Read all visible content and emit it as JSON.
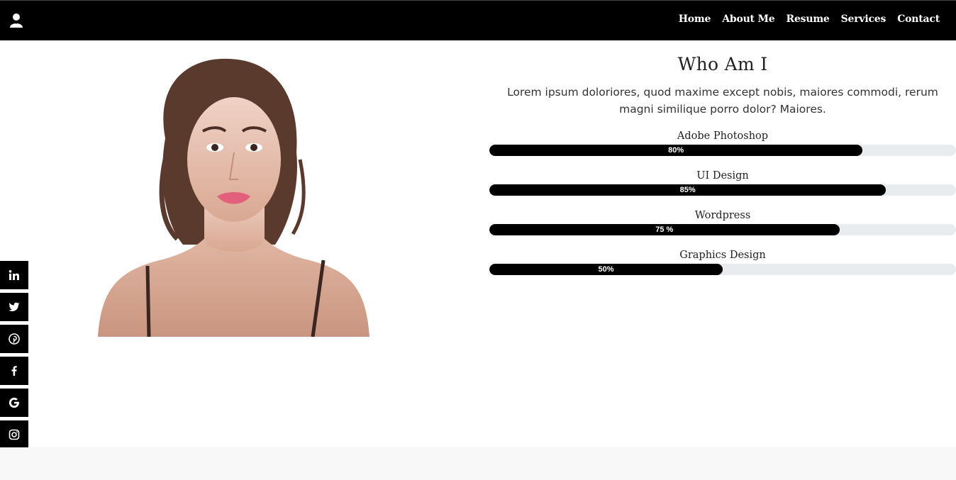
{
  "nav": {
    "brand_icon": "user-icon",
    "links": [
      "Home",
      "About Me",
      "Resume",
      "Services",
      "Contact"
    ]
  },
  "about": {
    "title": "Who Am I",
    "intro": "Lorem ipsum doloriores, quod maxime except nobis, maiores commodi, rerum magni similique porro dolor? Maiores.",
    "skills": [
      {
        "name": "Adobe Photoshop",
        "percent_label": "80%",
        "fraction": 0.8
      },
      {
        "name": "UI Design",
        "percent_label": "85%",
        "fraction": 0.85
      },
      {
        "name": "Wordpress",
        "percent_label": "75 %",
        "fraction": 0.75
      },
      {
        "name": "Graphics Design",
        "percent_label": "50%",
        "fraction": 0.5
      }
    ]
  },
  "social": [
    "linkedin-icon",
    "twitter-icon",
    "pinterest-icon",
    "facebook-icon",
    "google-icon",
    "instagram-icon"
  ],
  "colors": {
    "nav_bg": "#000000",
    "accent": "#000000",
    "track": "#e9ecef",
    "footer_band": "#f8f8f8"
  }
}
